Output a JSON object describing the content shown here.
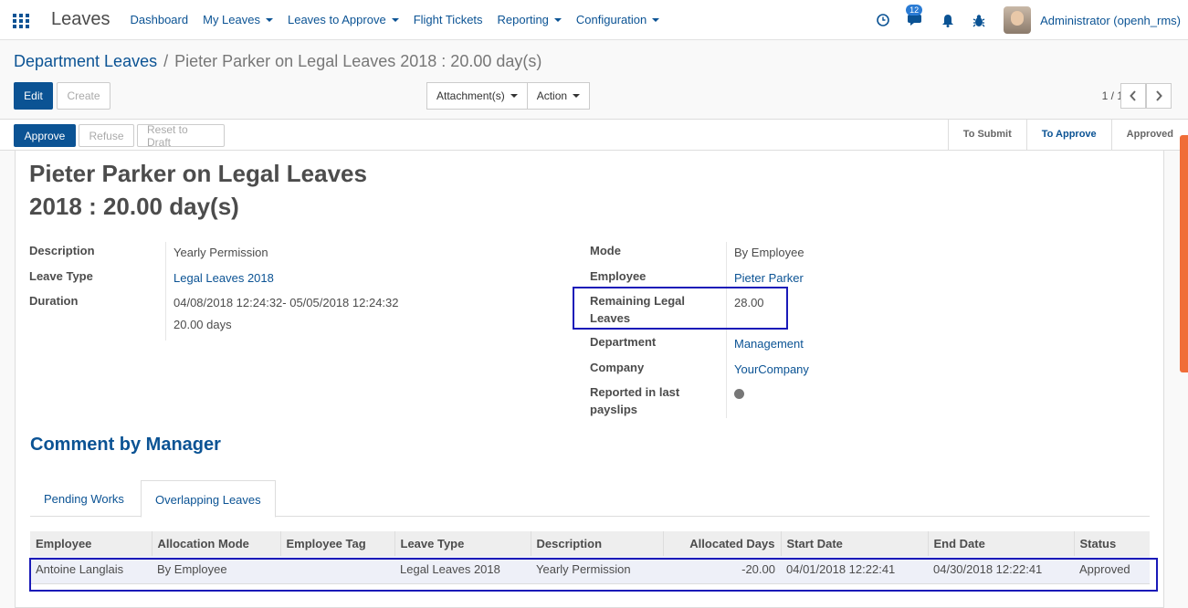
{
  "app": {
    "title": "Leaves"
  },
  "menu": {
    "dashboard": "Dashboard",
    "my_leaves": "My Leaves",
    "leaves_to_approve": "Leaves to Approve",
    "flight_tickets": "Flight Tickets",
    "reporting": "Reporting",
    "configuration": "Configuration"
  },
  "user": {
    "name": "Administrator (openh_rms)",
    "messages_count": "12"
  },
  "breadcrumb": {
    "parent": "Department Leaves",
    "separator": "/",
    "current": "Pieter Parker on Legal Leaves 2018 : 20.00 day(s)"
  },
  "toolbar": {
    "edit": "Edit",
    "create": "Create",
    "attachments": "Attachment(s)",
    "action": "Action"
  },
  "pager": {
    "text": "1 / 1"
  },
  "statusbar": {
    "approve": "Approve",
    "refuse": "Refuse",
    "reset": "Reset to Draft",
    "stages": [
      "To Submit",
      "To Approve",
      "Approved"
    ],
    "active_stage": "To Approve"
  },
  "record": {
    "title_line1": "Pieter Parker on Legal Leaves",
    "title_line2": "2018 : 20.00 day(s)",
    "left": {
      "description_label": "Description",
      "description": "Yearly Permission",
      "leave_type_label": "Leave Type",
      "leave_type": "Legal Leaves 2018",
      "duration_label": "Duration",
      "duration_range": "04/08/2018 12:24:32- 05/05/2018 12:24:32",
      "duration_days": "20.00 days"
    },
    "right": {
      "mode_label": "Mode",
      "mode": "By Employee",
      "employee_label": "Employee",
      "employee": "Pieter Parker",
      "remaining_label_1": "Remaining Legal",
      "remaining_label_2": "Leaves",
      "remaining": "28.00",
      "department_label": "Department",
      "department": "Management",
      "company_label": "Company",
      "company": "YourCompany",
      "reported_label_1": "Reported in last",
      "reported_label_2": "payslips"
    }
  },
  "comment_section": {
    "title": "Comment by Manager"
  },
  "tabs": {
    "pending": "Pending Works",
    "overlapping": "Overlapping Leaves"
  },
  "table": {
    "headers": [
      "Employee",
      "Allocation Mode",
      "Employee Tag",
      "Leave Type",
      "Description",
      "Allocated Days",
      "Start Date",
      "End Date",
      "Status"
    ],
    "rows": [
      [
        "Antoine Langlais",
        "By Employee",
        "",
        "Legal Leaves 2018",
        "Yearly Permission",
        "-20.00",
        "04/01/2018 12:22:41",
        "04/30/2018 12:22:41",
        "Approved"
      ]
    ]
  },
  "colors": {
    "primary": "#0b5394",
    "highlight_border": "#1a1ab8",
    "accent_scroll": "#f06d38"
  }
}
